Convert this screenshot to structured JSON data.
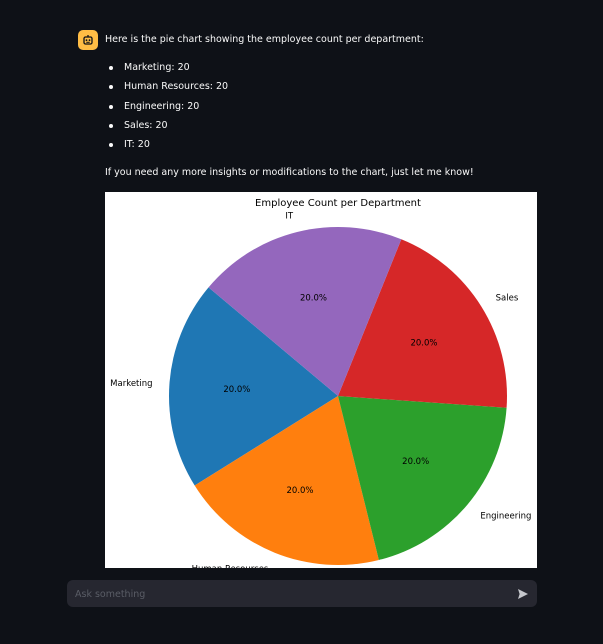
{
  "message": {
    "intro": "Here is the pie chart showing the employee count per department:",
    "bullets": [
      "Marketing: 20",
      "Human Resources: 20",
      "Engineering: 20",
      "Sales: 20",
      "IT: 20"
    ],
    "outro": "If you need any more insights or modifications to the chart, just let me know!",
    "avatar_icon": "robot-icon",
    "avatar_color": "#ffbd45"
  },
  "chart_data": {
    "type": "pie",
    "title": "Employee Count per Department",
    "labels": [
      "Marketing",
      "Human Resources",
      "Engineering",
      "Sales",
      "IT"
    ],
    "values": [
      20,
      20,
      20,
      20,
      20
    ],
    "percent_labels": [
      "20.0%",
      "20.0%",
      "20.0%",
      "20.0%",
      "20.0%"
    ],
    "colors": [
      "#1f77b4",
      "#ff7f0e",
      "#2ca02c",
      "#d62728",
      "#9467bd"
    ],
    "start_angle_deg": 140
  },
  "input": {
    "placeholder": "Ask something",
    "send_icon": "send-icon"
  }
}
